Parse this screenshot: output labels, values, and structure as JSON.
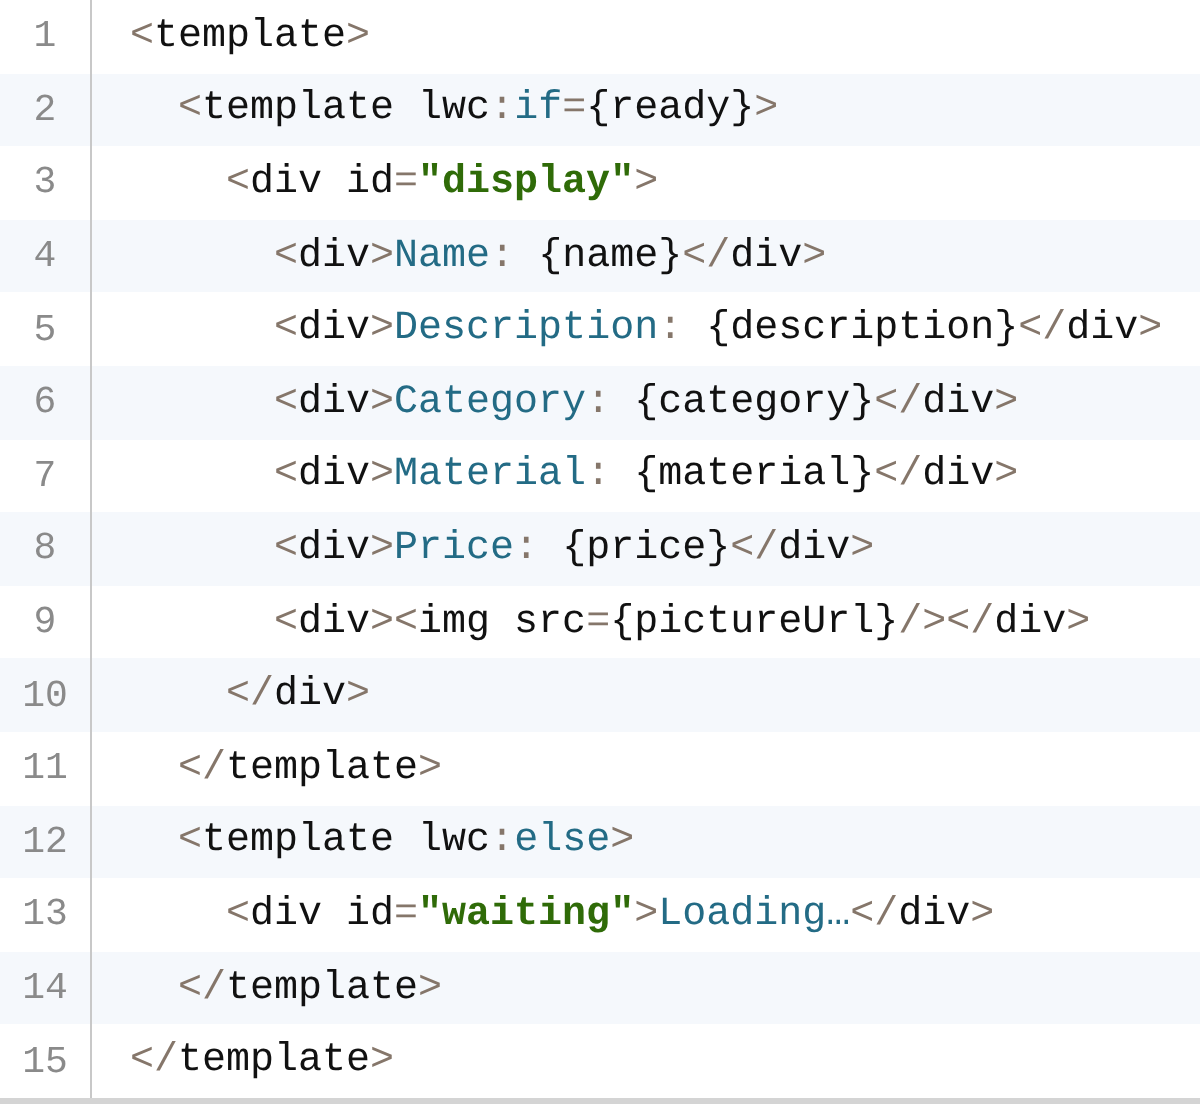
{
  "lines": [
    {
      "number": "1",
      "tokens": [
        {
          "kind": "punct",
          "text": "<"
        },
        {
          "kind": "tag",
          "text": "template"
        },
        {
          "kind": "punct",
          "text": ">"
        }
      ]
    },
    {
      "number": "2",
      "tokens": [
        {
          "kind": "punct",
          "text": "  <"
        },
        {
          "kind": "tag",
          "text": "template lwc"
        },
        {
          "kind": "punct",
          "text": ":"
        },
        {
          "kind": "keyword",
          "text": "if"
        },
        {
          "kind": "punct",
          "text": "="
        },
        {
          "kind": "tag",
          "text": "{ready}"
        },
        {
          "kind": "punct",
          "text": ">"
        }
      ]
    },
    {
      "number": "3",
      "tokens": [
        {
          "kind": "punct",
          "text": "    <"
        },
        {
          "kind": "tag",
          "text": "div id"
        },
        {
          "kind": "punct",
          "text": "="
        },
        {
          "kind": "string",
          "text": "\"display\""
        },
        {
          "kind": "punct",
          "text": ">"
        }
      ]
    },
    {
      "number": "4",
      "tokens": [
        {
          "kind": "punct",
          "text": "      <"
        },
        {
          "kind": "tag",
          "text": "div"
        },
        {
          "kind": "punct",
          "text": ">"
        },
        {
          "kind": "keyword",
          "text": "Name"
        },
        {
          "kind": "punct",
          "text": ": "
        },
        {
          "kind": "tag",
          "text": "{name}"
        },
        {
          "kind": "punct",
          "text": "</"
        },
        {
          "kind": "tag",
          "text": "div"
        },
        {
          "kind": "punct",
          "text": ">"
        }
      ]
    },
    {
      "number": "5",
      "tokens": [
        {
          "kind": "punct",
          "text": "      <"
        },
        {
          "kind": "tag",
          "text": "div"
        },
        {
          "kind": "punct",
          "text": ">"
        },
        {
          "kind": "keyword",
          "text": "Description"
        },
        {
          "kind": "punct",
          "text": ": "
        },
        {
          "kind": "tag",
          "text": "{description}"
        },
        {
          "kind": "punct",
          "text": "</"
        },
        {
          "kind": "tag",
          "text": "div"
        },
        {
          "kind": "punct",
          "text": ">"
        }
      ]
    },
    {
      "number": "6",
      "tokens": [
        {
          "kind": "punct",
          "text": "      <"
        },
        {
          "kind": "tag",
          "text": "div"
        },
        {
          "kind": "punct",
          "text": ">"
        },
        {
          "kind": "keyword",
          "text": "Category"
        },
        {
          "kind": "punct",
          "text": ": "
        },
        {
          "kind": "tag",
          "text": "{category}"
        },
        {
          "kind": "punct",
          "text": "</"
        },
        {
          "kind": "tag",
          "text": "div"
        },
        {
          "kind": "punct",
          "text": ">"
        }
      ]
    },
    {
      "number": "7",
      "tokens": [
        {
          "kind": "punct",
          "text": "      <"
        },
        {
          "kind": "tag",
          "text": "div"
        },
        {
          "kind": "punct",
          "text": ">"
        },
        {
          "kind": "keyword",
          "text": "Material"
        },
        {
          "kind": "punct",
          "text": ": "
        },
        {
          "kind": "tag",
          "text": "{material}"
        },
        {
          "kind": "punct",
          "text": "</"
        },
        {
          "kind": "tag",
          "text": "div"
        },
        {
          "kind": "punct",
          "text": ">"
        }
      ]
    },
    {
      "number": "8",
      "tokens": [
        {
          "kind": "punct",
          "text": "      <"
        },
        {
          "kind": "tag",
          "text": "div"
        },
        {
          "kind": "punct",
          "text": ">"
        },
        {
          "kind": "keyword",
          "text": "Price"
        },
        {
          "kind": "punct",
          "text": ": "
        },
        {
          "kind": "tag",
          "text": "{price}"
        },
        {
          "kind": "punct",
          "text": "</"
        },
        {
          "kind": "tag",
          "text": "div"
        },
        {
          "kind": "punct",
          "text": ">"
        }
      ]
    },
    {
      "number": "9",
      "tokens": [
        {
          "kind": "punct",
          "text": "      <"
        },
        {
          "kind": "tag",
          "text": "div"
        },
        {
          "kind": "punct",
          "text": "><"
        },
        {
          "kind": "tag",
          "text": "img src"
        },
        {
          "kind": "punct",
          "text": "="
        },
        {
          "kind": "tag",
          "text": "{pictureUrl}"
        },
        {
          "kind": "punct",
          "text": "/></"
        },
        {
          "kind": "tag",
          "text": "div"
        },
        {
          "kind": "punct",
          "text": ">"
        }
      ]
    },
    {
      "number": "10",
      "tokens": [
        {
          "kind": "punct",
          "text": "    </"
        },
        {
          "kind": "tag",
          "text": "div"
        },
        {
          "kind": "punct",
          "text": ">"
        }
      ]
    },
    {
      "number": "11",
      "tokens": [
        {
          "kind": "punct",
          "text": "  </"
        },
        {
          "kind": "tag",
          "text": "template"
        },
        {
          "kind": "punct",
          "text": ">"
        }
      ]
    },
    {
      "number": "12",
      "tokens": [
        {
          "kind": "punct",
          "text": "  <"
        },
        {
          "kind": "tag",
          "text": "template lwc"
        },
        {
          "kind": "punct",
          "text": ":"
        },
        {
          "kind": "keyword",
          "text": "else"
        },
        {
          "kind": "punct",
          "text": ">"
        }
      ]
    },
    {
      "number": "13",
      "tokens": [
        {
          "kind": "punct",
          "text": "    <"
        },
        {
          "kind": "tag",
          "text": "div id"
        },
        {
          "kind": "punct",
          "text": "="
        },
        {
          "kind": "string",
          "text": "\"waiting\""
        },
        {
          "kind": "punct",
          "text": ">"
        },
        {
          "kind": "keyword",
          "text": "Loading…"
        },
        {
          "kind": "punct",
          "text": "</"
        },
        {
          "kind": "tag",
          "text": "div"
        },
        {
          "kind": "punct",
          "text": ">"
        }
      ]
    },
    {
      "number": "14",
      "tokens": [
        {
          "kind": "punct",
          "text": "  </"
        },
        {
          "kind": "tag",
          "text": "template"
        },
        {
          "kind": "punct",
          "text": ">"
        }
      ]
    },
    {
      "number": "15",
      "tokens": [
        {
          "kind": "punct",
          "text": "</"
        },
        {
          "kind": "tag",
          "text": "template"
        },
        {
          "kind": "punct",
          "text": ">"
        }
      ]
    }
  ]
}
